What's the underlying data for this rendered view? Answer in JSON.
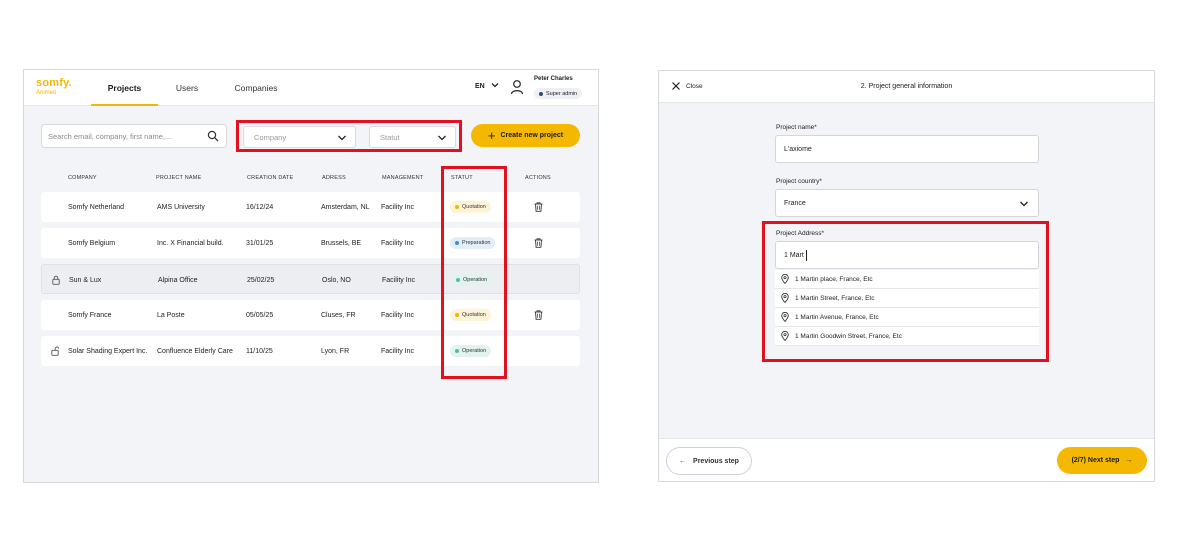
{
  "left": {
    "logo": {
      "brand": "somfy.",
      "sub": "Animeo"
    },
    "nav": [
      {
        "label": "Projects"
      },
      {
        "label": "Users"
      },
      {
        "label": "Companies"
      }
    ],
    "lang": "EN",
    "user": {
      "name": "Peter Charles",
      "role": "Super admin"
    },
    "search": {
      "placeholder": "Search email, company, first name,..."
    },
    "filters": {
      "company": "Company",
      "statut": "Statut"
    },
    "create_button": "Create new project",
    "columns": [
      "COMPANY",
      "PROJECT NAME",
      "CREATION DATE",
      "ADRESS",
      "MANAGEMENT",
      "STATUT",
      "ACTIONS"
    ],
    "rows": [
      {
        "company": "Somfy Netherland",
        "project": "AMS University",
        "date": "16/12/24",
        "address": "Amsterdam, NL",
        "management": "Facility Inc",
        "status": "Quotation",
        "lock": "",
        "deletable": true
      },
      {
        "company": "Somfy Belgium",
        "project": "Inc. X Financial build.",
        "date": "31/01/25",
        "address": "Brussels, BE",
        "management": "Facility Inc",
        "status": "Preparation",
        "lock": "",
        "deletable": true
      },
      {
        "company": "Sun & Lux",
        "project": "Alpina Office",
        "date": "25/02/25",
        "address": "Oslo, NO",
        "management": "Facility Inc",
        "status": "Operation",
        "lock": "locked",
        "deletable": false
      },
      {
        "company": "Somfy France",
        "project": "La Poste",
        "date": "05/05/25",
        "address": "Cluses, FR",
        "management": "Facility Inc",
        "status": "Quotation",
        "lock": "",
        "deletable": true
      },
      {
        "company": "Solar Shading Expert Inc.",
        "project": "Confluence Elderly Care",
        "date": "11/10/25",
        "address": "Lyon, FR",
        "management": "Facility Inc",
        "status": "Operation",
        "lock": "unlocked",
        "deletable": false
      }
    ],
    "status_colors": {
      "Quotation": {
        "bg": "#fdf3d6",
        "dot": "#f2b705"
      },
      "Preparation": {
        "bg": "#e3eef8",
        "dot": "#3b8fd0"
      },
      "Operation": {
        "bg": "#e2f3ef",
        "dot": "#4cc1a6"
      }
    }
  },
  "right": {
    "close_label": "Close",
    "step_title": "2. Project general information",
    "project_name": {
      "label": "Project name*",
      "value": "L'axiome"
    },
    "country": {
      "label": "Project country*",
      "value": "France"
    },
    "address": {
      "label": "Project Address*",
      "value": "1 Mart"
    },
    "suggestions": [
      "1 Martin place, France, Etc",
      "1 Martin Street, France, Etc",
      "1 Martin Avenue, France, Etc",
      "1 Martin Goodwin Street, France, Etc"
    ],
    "prev_button": "Previous step",
    "next_button": "(2/7) Next step"
  },
  "highlight_color": "#e5101f",
  "accent_color": "#f5b800"
}
